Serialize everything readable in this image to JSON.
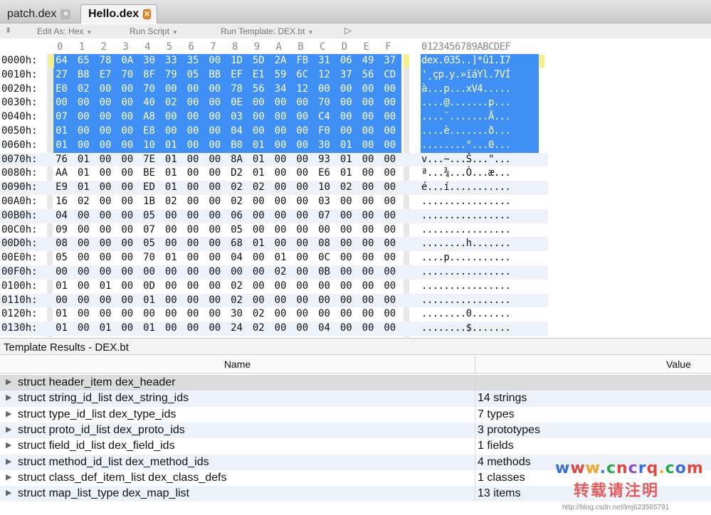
{
  "tabs": [
    {
      "label": "patch.dex",
      "active": false,
      "close": "■"
    },
    {
      "label": "Hello.dex",
      "active": true,
      "close": "✕"
    }
  ],
  "toolbar": {
    "collapse_icon": "double-chevron-down-icon",
    "edit_as": "Edit As: Hex",
    "run_script": "Run Script",
    "run_template": "Run Template: DEX.bt",
    "run_icon": "play-icon"
  },
  "hex": {
    "columns": [
      "0",
      "1",
      "2",
      "3",
      "4",
      "5",
      "6",
      "7",
      "8",
      "9",
      "A",
      "B",
      "C",
      "D",
      "E",
      "F"
    ],
    "ascii_header": "0123456789ABCDEF",
    "selection_rows": 7,
    "rows": [
      {
        "addr": "0000h:",
        "bytes": [
          "64",
          "65",
          "78",
          "0A",
          "30",
          "33",
          "35",
          "00",
          "1D",
          "5D",
          "2A",
          "FB",
          "31",
          "06",
          "49",
          "37"
        ],
        "ascii": "dex.035..]*û1.I7"
      },
      {
        "addr": "0010h:",
        "bytes": [
          "27",
          "B8",
          "E7",
          "70",
          "8F",
          "79",
          "05",
          "BB",
          "EF",
          "E1",
          "59",
          "6C",
          "12",
          "37",
          "56",
          "CD"
        ],
        "ascii": "'¸çp.y.»ïáYl.7VÍ"
      },
      {
        "addr": "0020h:",
        "bytes": [
          "E0",
          "02",
          "00",
          "00",
          "70",
          "00",
          "00",
          "00",
          "78",
          "56",
          "34",
          "12",
          "00",
          "00",
          "00",
          "00"
        ],
        "ascii": "à...p...xV4....."
      },
      {
        "addr": "0030h:",
        "bytes": [
          "00",
          "00",
          "00",
          "00",
          "40",
          "02",
          "00",
          "00",
          "0E",
          "00",
          "00",
          "00",
          "70",
          "00",
          "00",
          "00"
        ],
        "ascii": "....@.......p..."
      },
      {
        "addr": "0040h:",
        "bytes": [
          "07",
          "00",
          "00",
          "00",
          "A8",
          "00",
          "00",
          "00",
          "03",
          "00",
          "00",
          "00",
          "C4",
          "00",
          "00",
          "00"
        ],
        "ascii": "....¨.......Ä..."
      },
      {
        "addr": "0050h:",
        "bytes": [
          "01",
          "00",
          "00",
          "00",
          "E8",
          "00",
          "00",
          "00",
          "04",
          "00",
          "00",
          "00",
          "F0",
          "00",
          "00",
          "00"
        ],
        "ascii": "....è.......ð..."
      },
      {
        "addr": "0060h:",
        "bytes": [
          "01",
          "00",
          "00",
          "00",
          "10",
          "01",
          "00",
          "00",
          "B0",
          "01",
          "00",
          "00",
          "30",
          "01",
          "00",
          "00"
        ],
        "ascii": "........°...0..."
      },
      {
        "addr": "0070h:",
        "bytes": [
          "76",
          "01",
          "00",
          "00",
          "7E",
          "01",
          "00",
          "00",
          "8A",
          "01",
          "00",
          "00",
          "93",
          "01",
          "00",
          "00"
        ],
        "ascii": "v...~...Š...\"..."
      },
      {
        "addr": "0080h:",
        "bytes": [
          "AA",
          "01",
          "00",
          "00",
          "BE",
          "01",
          "00",
          "00",
          "D2",
          "01",
          "00",
          "00",
          "E6",
          "01",
          "00",
          "00"
        ],
        "ascii": "ª...¾...Ò...æ..."
      },
      {
        "addr": "0090h:",
        "bytes": [
          "E9",
          "01",
          "00",
          "00",
          "ED",
          "01",
          "00",
          "00",
          "02",
          "02",
          "00",
          "00",
          "10",
          "02",
          "00",
          "00"
        ],
        "ascii": "é...í..........."
      },
      {
        "addr": "00A0h:",
        "bytes": [
          "16",
          "02",
          "00",
          "00",
          "1B",
          "02",
          "00",
          "00",
          "02",
          "00",
          "00",
          "00",
          "03",
          "00",
          "00",
          "00"
        ],
        "ascii": "................"
      },
      {
        "addr": "00B0h:",
        "bytes": [
          "04",
          "00",
          "00",
          "00",
          "05",
          "00",
          "00",
          "00",
          "06",
          "00",
          "00",
          "00",
          "07",
          "00",
          "00",
          "00"
        ],
        "ascii": "................"
      },
      {
        "addr": "00C0h:",
        "bytes": [
          "09",
          "00",
          "00",
          "00",
          "07",
          "00",
          "00",
          "00",
          "05",
          "00",
          "00",
          "00",
          "00",
          "00",
          "00",
          "00"
        ],
        "ascii": "................"
      },
      {
        "addr": "00D0h:",
        "bytes": [
          "08",
          "00",
          "00",
          "00",
          "05",
          "00",
          "00",
          "00",
          "68",
          "01",
          "00",
          "00",
          "08",
          "00",
          "00",
          "00"
        ],
        "ascii": "........h......."
      },
      {
        "addr": "00E0h:",
        "bytes": [
          "05",
          "00",
          "00",
          "00",
          "70",
          "01",
          "00",
          "00",
          "04",
          "00",
          "01",
          "00",
          "0C",
          "00",
          "00",
          "00"
        ],
        "ascii": "....p..........."
      },
      {
        "addr": "00F0h:",
        "bytes": [
          "00",
          "00",
          "00",
          "00",
          "00",
          "00",
          "00",
          "00",
          "00",
          "00",
          "02",
          "00",
          "0B",
          "00",
          "00",
          "00"
        ],
        "ascii": "................"
      },
      {
        "addr": "0100h:",
        "bytes": [
          "01",
          "00",
          "01",
          "00",
          "0D",
          "00",
          "00",
          "00",
          "02",
          "00",
          "00",
          "00",
          "00",
          "00",
          "00",
          "00"
        ],
        "ascii": "................"
      },
      {
        "addr": "0110h:",
        "bytes": [
          "00",
          "00",
          "00",
          "00",
          "01",
          "00",
          "00",
          "00",
          "02",
          "00",
          "00",
          "00",
          "00",
          "00",
          "00",
          "00"
        ],
        "ascii": "................"
      },
      {
        "addr": "0120h:",
        "bytes": [
          "01",
          "00",
          "00",
          "00",
          "00",
          "00",
          "00",
          "00",
          "30",
          "02",
          "00",
          "00",
          "00",
          "00",
          "00",
          "00"
        ],
        "ascii": "........0......."
      },
      {
        "addr": "0130h:",
        "bytes": [
          "01",
          "00",
          "01",
          "00",
          "01",
          "00",
          "00",
          "00",
          "24",
          "02",
          "00",
          "00",
          "04",
          "00",
          "00",
          "00"
        ],
        "ascii": "........$......."
      }
    ]
  },
  "template": {
    "title": "Template Results - DEX.bt",
    "col_name": "Name",
    "col_value": "Value",
    "rows": [
      {
        "name": "struct header_item dex_header",
        "value": ""
      },
      {
        "name": "struct string_id_list dex_string_ids",
        "value": "14 strings"
      },
      {
        "name": "struct type_id_list dex_type_ids",
        "value": "7 types"
      },
      {
        "name": "struct proto_id_list dex_proto_ids",
        "value": "3 prototypes"
      },
      {
        "name": "struct field_id_list dex_field_ids",
        "value": "1 fields"
      },
      {
        "name": "struct method_id_list dex_method_ids",
        "value": "4 methods"
      },
      {
        "name": "struct class_def_item_list dex_class_defs",
        "value": "1 classes"
      },
      {
        "name": "struct map_list_type dex_map_list",
        "value": "13 items"
      }
    ]
  },
  "watermark": {
    "site": "www.cncrq.com",
    "site_colors": [
      "#3b6fd6",
      "#e0473e",
      "#f1a52a",
      "#3b6fd6",
      "#2aa84a",
      "#e0473e",
      "#8a4fc7",
      "#3b6fd6",
      "#e0473e",
      "#f1a52a",
      "#2aa84a",
      "#3b6fd6",
      "#e0473e"
    ],
    "notice": "转载请注明",
    "blog": "http://blog.csdn.net/lmj623565791"
  },
  "colors": {
    "selection": "#3f8ff5",
    "stripe": "#eef2fa",
    "cursor": "#f5f08a"
  }
}
